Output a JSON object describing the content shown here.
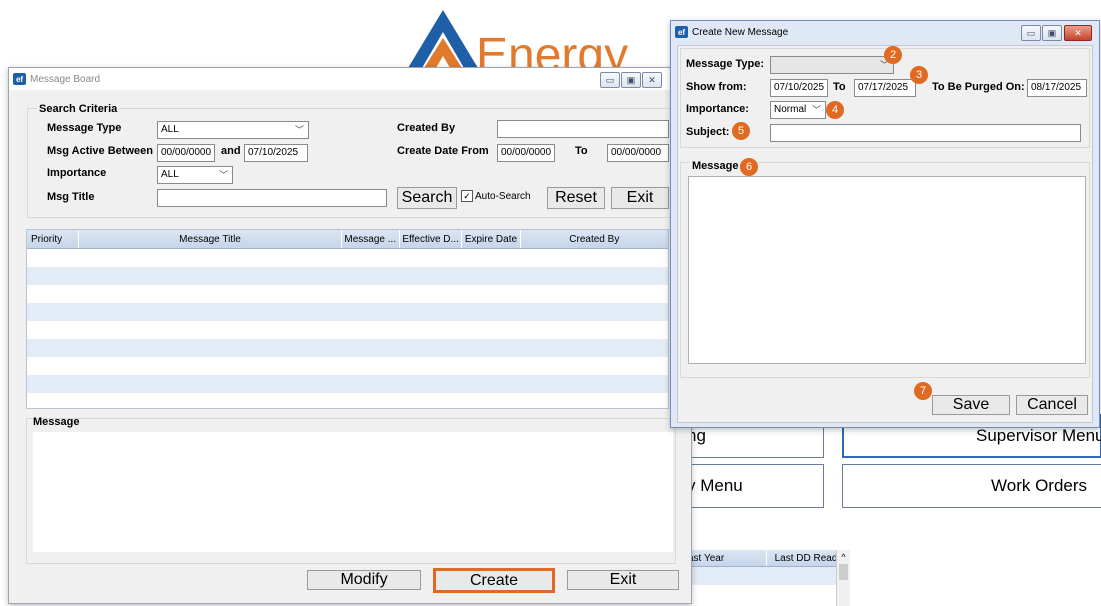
{
  "background": {
    "logo_text": "Energy",
    "buttons": {
      "training_partial": "ng",
      "supervisor_menu": "Supervisor Menu",
      "menu_partial": "y Menu",
      "work_orders": "Work Orders"
    },
    "table_headers": [
      "ast Year",
      "Last DD Read"
    ]
  },
  "message_board": {
    "title": "Message Board",
    "search_criteria": {
      "legend": "Search Criteria",
      "message_type_label": "Message Type",
      "message_type_value": "ALL",
      "msg_active_between_label": "Msg Active Between",
      "active_from": "00/00/0000",
      "and_label": "and",
      "active_to": "07/10/2025",
      "importance_label": "Importance",
      "importance_value": "ALL",
      "msg_title_label": "Msg Title",
      "msg_title_value": "",
      "created_by_label": "Created By",
      "created_by_value": "",
      "create_date_from_label": "Create Date From",
      "create_from": "00/00/0000",
      "to_label": "To",
      "create_to": "00/00/0000",
      "search_button": "Search",
      "auto_search_label": "Auto-Search",
      "auto_search_checked": true,
      "reset_button": "Reset",
      "exit_button": "Exit"
    },
    "grid": {
      "columns": [
        "Priority",
        "Message Title",
        "Message ...",
        "Effective D...",
        "Expire Date",
        "Created By"
      ],
      "rows": []
    },
    "message_label": "Message",
    "message_text": "",
    "buttons": {
      "modify": "Modify",
      "create": "Create",
      "exit": "Exit"
    }
  },
  "create_message": {
    "title": "Create New Message",
    "message_type_label": "Message Type:",
    "message_type_value": "",
    "show_from_label": "Show from:",
    "show_from_value": "07/10/2025",
    "to_label": "To",
    "to_value": "07/17/2025",
    "purge_label": "To Be Purged On:",
    "purge_value": "08/17/2025",
    "importance_label": "Importance:",
    "importance_value": "Normal",
    "subject_label": "Subject:",
    "subject_value": "",
    "message_label": "Message",
    "message_value": "",
    "save_button": "Save",
    "cancel_button": "Cancel",
    "step_badges": [
      "2",
      "3",
      "4",
      "5",
      "6",
      "7"
    ]
  },
  "colors": {
    "highlight": "#e06a22",
    "grid_header": "#c6d5ea",
    "grid_alt_row": "#e3ecf6",
    "logo_blue": "#1f5fa8",
    "logo_orange": "#e27a2e"
  }
}
